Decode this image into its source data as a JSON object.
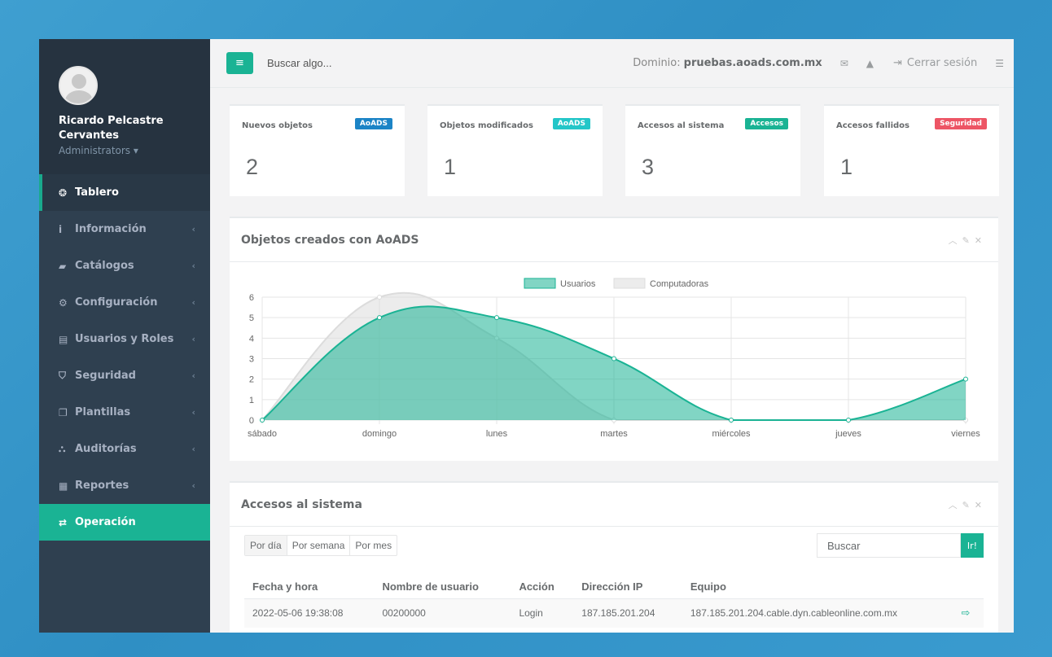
{
  "user": {
    "name": "Ricardo Pelcastre Cervantes",
    "role": "Administrators ▾"
  },
  "sidebar": {
    "items": [
      {
        "icon": "tachometer-icon",
        "glyph": "❂",
        "label": "Tablero",
        "active": true
      },
      {
        "icon": "info-icon",
        "glyph": "i",
        "label": "Información"
      },
      {
        "icon": "book-icon",
        "glyph": "▰",
        "label": "Catálogos"
      },
      {
        "icon": "cogs-icon",
        "glyph": "⚙",
        "label": "Configuración"
      },
      {
        "icon": "id-card-icon",
        "glyph": "▤",
        "label": "Usuarios y Roles"
      },
      {
        "icon": "shield-icon",
        "glyph": "⛉",
        "label": "Seguridad"
      },
      {
        "icon": "copy-icon",
        "glyph": "❐",
        "label": "Plantillas"
      },
      {
        "icon": "binoculars-icon",
        "glyph": "⛬",
        "label": "Auditorías"
      },
      {
        "icon": "file-icon",
        "glyph": "▦",
        "label": "Reportes"
      },
      {
        "icon": "exchange-icon",
        "glyph": "⇄",
        "label": "Operación",
        "highlight": true
      }
    ]
  },
  "topbar": {
    "search_placeholder": "Buscar algo...",
    "domain_label": "Dominio:",
    "domain_value": "pruebas.aoads.com.mx",
    "logout_label": "Cerrar sesión"
  },
  "stats": [
    {
      "title": "Nuevos objetos",
      "badge": "AoADS",
      "badge_color": "#1c84c6",
      "value": "2"
    },
    {
      "title": "Objetos modificados",
      "badge": "AoADS",
      "badge_color": "#23c6c8",
      "value": "1"
    },
    {
      "title": "Accesos al sistema",
      "badge": "Accesos",
      "badge_color": "#1ab394",
      "value": "3"
    },
    {
      "title": "Accesos fallidos",
      "badge": "Seguridad",
      "badge_color": "#ed5565",
      "value": "1"
    }
  ],
  "chart_panel": {
    "title": "Objetos creados con AoADS"
  },
  "chart_data": {
    "type": "area",
    "categories": [
      "sábado",
      "domingo",
      "lunes",
      "martes",
      "miércoles",
      "jueves",
      "viernes"
    ],
    "series": [
      {
        "name": "Usuarios",
        "values": [
          0,
          5,
          5,
          3,
          0,
          0,
          2
        ],
        "color": "#1ab394"
      },
      {
        "name": "Computadoras",
        "values": [
          0,
          6,
          4,
          0,
          0,
          0,
          0
        ],
        "color": "#dcdcdc"
      }
    ],
    "yticks": [
      "0",
      "1",
      "2",
      "3",
      "4",
      "5",
      "6"
    ],
    "ylim": [
      0,
      6
    ],
    "legend_position": "top",
    "grid": true
  },
  "table_panel": {
    "title": "Accesos al sistema",
    "segments": [
      "Por día",
      "Por semana",
      "Por mes"
    ],
    "search_placeholder": "Buscar",
    "search_button": "Ir!",
    "columns": [
      "Fecha y hora",
      "Nombre de usuario",
      "Acción",
      "Dirección IP",
      "Equipo"
    ],
    "rows": [
      [
        "2022-05-06 19:38:08",
        "00200000",
        "Login",
        "187.185.201.204",
        "187.185.201.204.cable.dyn.cableonline.com.mx"
      ]
    ]
  }
}
